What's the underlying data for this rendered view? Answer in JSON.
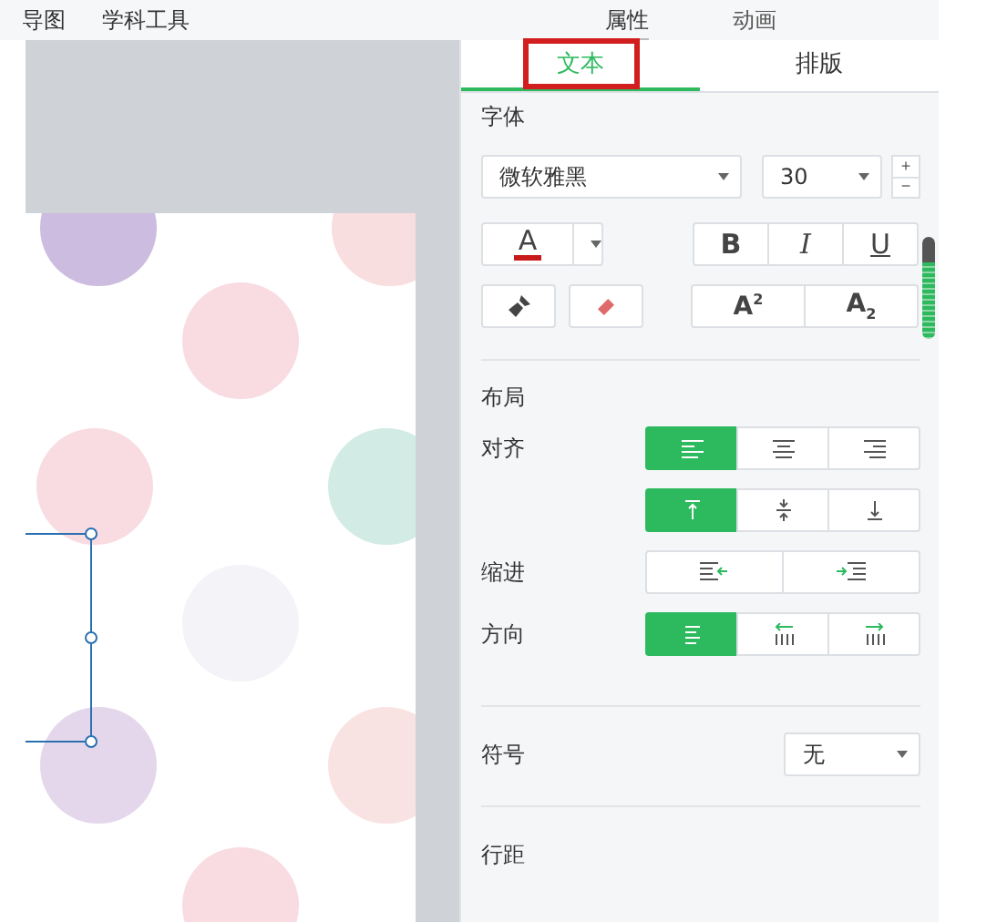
{
  "top_menu": [
    {
      "label": "导图"
    },
    {
      "label": "学科工具"
    }
  ],
  "panel_tabs": [
    {
      "label": "属性",
      "selected": true
    },
    {
      "label": "动画",
      "selected": false
    }
  ],
  "sub_tabs": [
    {
      "label": "文本",
      "selected": true,
      "boxed": true
    },
    {
      "label": "排版",
      "selected": false,
      "boxed": false
    }
  ],
  "font": {
    "heading": "字体",
    "family": "微软雅黑",
    "size": "30",
    "plus": "+",
    "minus": "−",
    "color_letter": "A",
    "styles": [
      {
        "label": "B",
        "kind": "bold"
      },
      {
        "label": "I",
        "kind": "italic"
      },
      {
        "label": "U",
        "kind": "underline"
      }
    ],
    "scripts": [
      {
        "letter": "A",
        "mark": "2",
        "kind": "superscript"
      },
      {
        "letter": "A",
        "mark": "2",
        "kind": "subscript"
      }
    ]
  },
  "layout": {
    "heading": "布局",
    "rows": [
      {
        "label": "对齐",
        "kind": "halign",
        "buttons": [
          {
            "selected": true
          },
          {
            "selected": false
          },
          {
            "selected": false
          }
        ]
      },
      {
        "kind": "valign",
        "buttons": [
          {
            "selected": true
          },
          {
            "selected": false
          },
          {
            "selected": false
          }
        ]
      },
      {
        "label": "缩进",
        "kind": "indent",
        "buttons": [
          {
            "selected": false
          },
          {
            "selected": false
          }
        ]
      },
      {
        "label": "方向",
        "kind": "direction",
        "buttons": [
          {
            "selected": true
          },
          {
            "selected": false
          },
          {
            "selected": false
          }
        ]
      }
    ]
  },
  "symbol": {
    "label": "符号",
    "value": "无"
  },
  "line_spacing": {
    "label": "行距"
  }
}
